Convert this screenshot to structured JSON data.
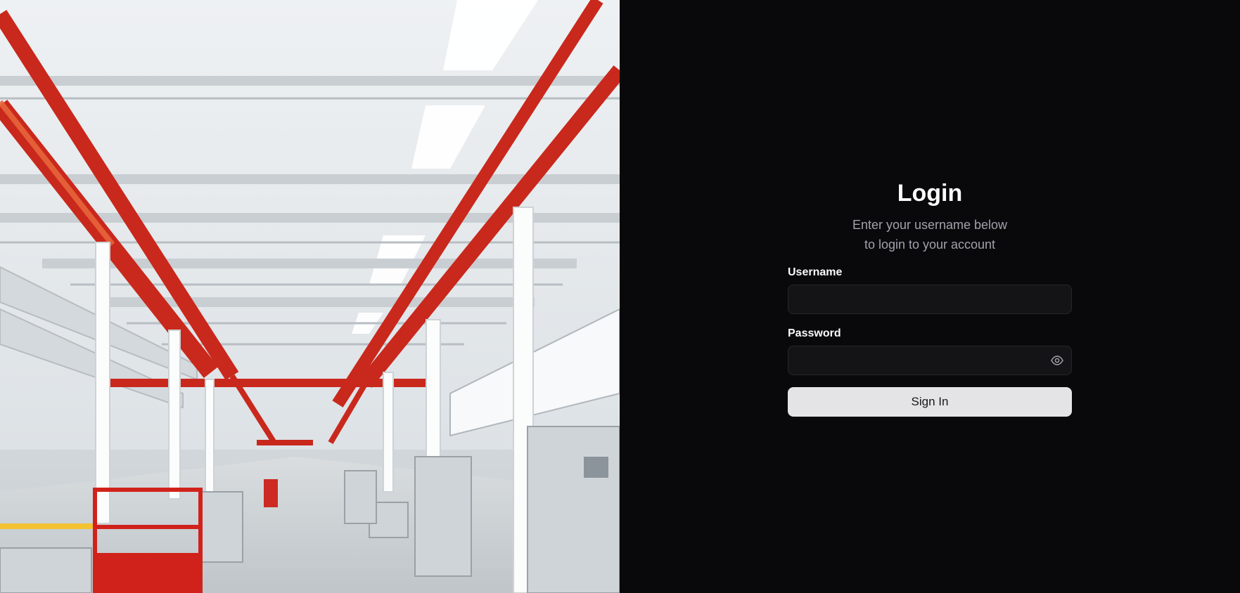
{
  "photo": {
    "icon": "factory-floor-photo"
  },
  "login": {
    "title": "Login",
    "subtitle_line1": "Enter your username below",
    "subtitle_line2": "to login to your account",
    "username": {
      "label": "Username",
      "value": "",
      "placeholder": ""
    },
    "password": {
      "label": "Password",
      "value": "",
      "placeholder": "",
      "toggle_icon": "eye-icon"
    },
    "submit_label": "Sign In"
  },
  "colors": {
    "background": "#09090b",
    "input_background": "#141416",
    "input_border": "#27272a",
    "button_background": "#e4e4e7",
    "title_text": "#fafafa",
    "muted_text": "#a1a1aa",
    "accent_red": "#c9281c"
  }
}
